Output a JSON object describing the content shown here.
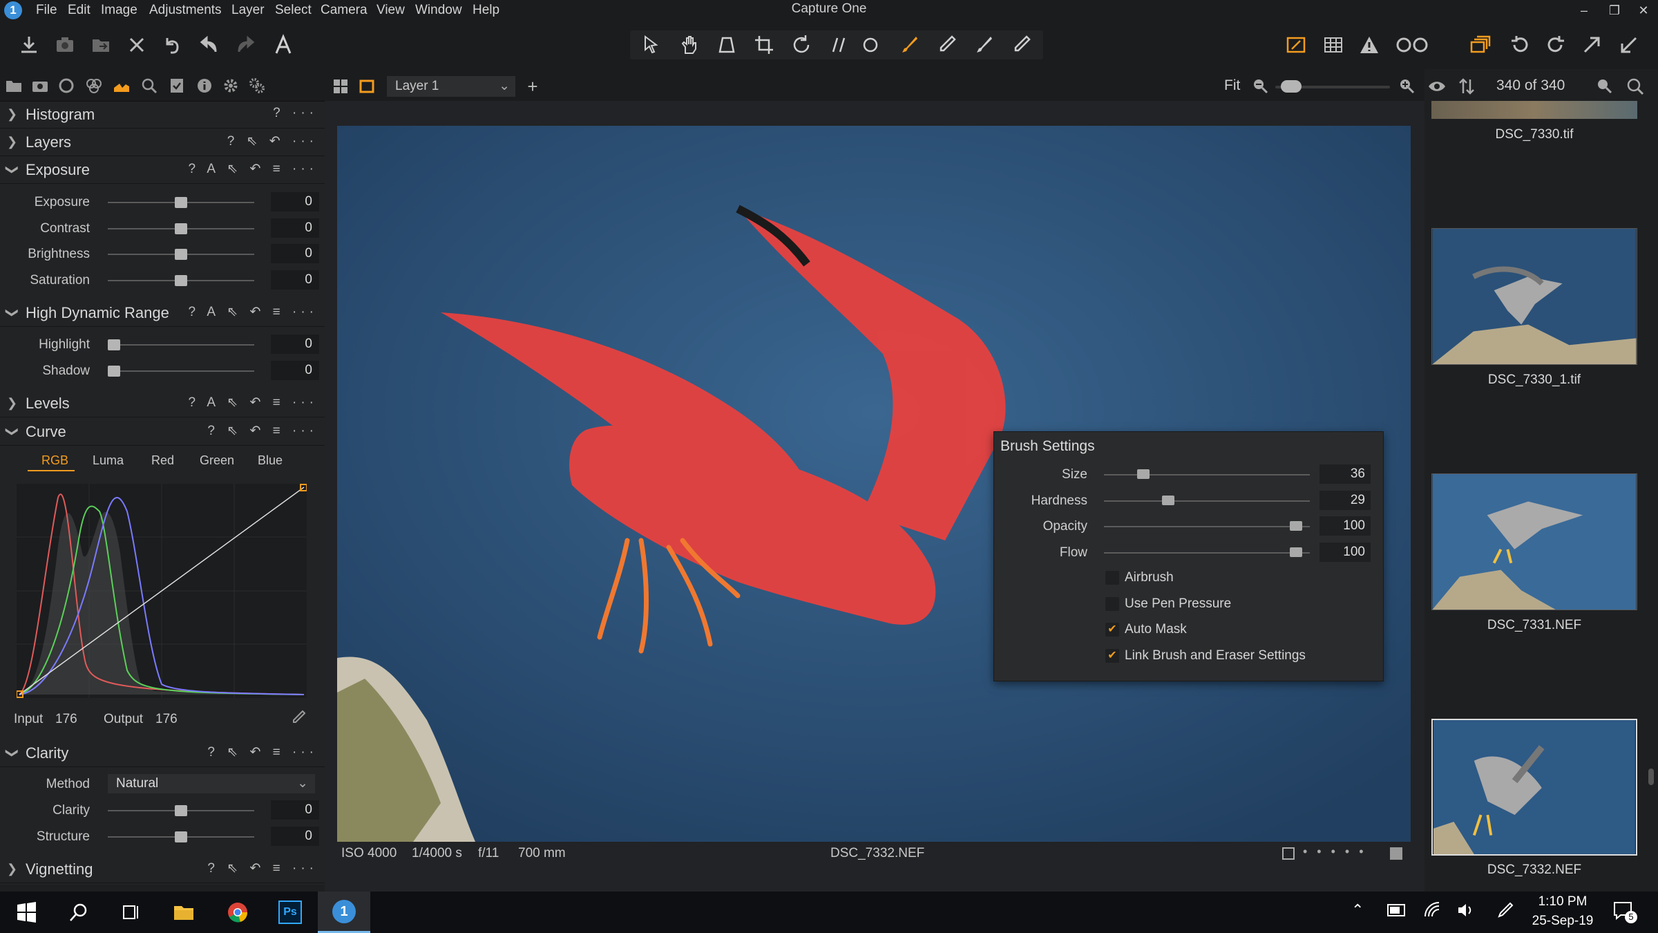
{
  "app": {
    "title": "Capture One",
    "icon_glyph": "1"
  },
  "menu": [
    "File",
    "Edit",
    "Image",
    "Adjustments",
    "Layer",
    "Select",
    "Camera",
    "View",
    "Window",
    "Help"
  ],
  "window_controls": {
    "minimize": "–",
    "maximize": "❐",
    "close": "✕"
  },
  "toolbar": {
    "left_icons": [
      "import-icon",
      "camera-icon",
      "move-to-icon",
      "delete-icon",
      "undo-all-icon",
      "undo-icon",
      "redo-icon",
      "text-icon"
    ],
    "tool_icons": [
      "cursor-tool-icon",
      "pan-tool-icon",
      "keystone-tool-icon",
      "crop-tool-icon",
      "rotate-tool-icon",
      "straighten-tool-icon",
      "spot-tool-icon",
      "brush-tool-icon",
      "eyedropper-tool-icon",
      "eraser-tool-icon",
      "gradient-tool-icon"
    ],
    "right_icons": [
      "exposure-warning-icon",
      "grid-icon",
      "warning-icon",
      "proof-icon",
      "copy-icon",
      "rotate-left-icon",
      "rotate-right-icon",
      "expand-icon",
      "compress-icon"
    ]
  },
  "left_tabs": [
    "library-icon",
    "capture-icon",
    "lens-icon",
    "color-icon",
    "exposure-tab-icon",
    "details-icon",
    "metadata-icon",
    "info-icon",
    "settings-icon",
    "styles-icon"
  ],
  "viewer_bar": {
    "layer": "Layer 1",
    "fit": "Fit",
    "count": "340 of 340",
    "zoom_level": 0.06
  },
  "sections": {
    "histogram": {
      "title": "Histogram",
      "icons": "? ···"
    },
    "layers": {
      "title": "Layers",
      "icons": "? ⇖ ↶ ···"
    },
    "exposure": {
      "title": "Exposure",
      "icons": "? A ⇖ ↶ ≡ ···",
      "rows": [
        {
          "label": "Exposure",
          "value": "0",
          "knob": 0.5
        },
        {
          "label": "Contrast",
          "value": "0",
          "knob": 0.5
        },
        {
          "label": "Brightness",
          "value": "0",
          "knob": 0.5
        },
        {
          "label": "Saturation",
          "value": "0",
          "knob": 0.5
        }
      ]
    },
    "hdr": {
      "title": "High Dynamic Range",
      "icons": "? A ⇖ ↶ ≡ ···",
      "rows": [
        {
          "label": "Highlight",
          "value": "0",
          "knob": 0.0
        },
        {
          "label": "Shadow",
          "value": "0",
          "knob": 0.0
        }
      ]
    },
    "levels": {
      "title": "Levels",
      "icons": "? A ⇖ ↶ ≡ ···"
    },
    "curve": {
      "title": "Curve",
      "icons": "? ⇖ ↶ ≡ ···",
      "tabs": [
        "RGB",
        "Luma",
        "Red",
        "Green",
        "Blue"
      ],
      "active_tab": "RGB",
      "input_label": "Input",
      "input_value": "176",
      "output_label": "Output",
      "output_value": "176"
    },
    "clarity": {
      "title": "Clarity",
      "icons": "? ⇖ ↶ ≡ ···",
      "method_label": "Method",
      "method_value": "Natural",
      "rows": [
        {
          "label": "Clarity",
          "value": "0",
          "knob": 0.5
        },
        {
          "label": "Structure",
          "value": "0",
          "knob": 0.5
        }
      ]
    },
    "vignetting": {
      "title": "Vignetting",
      "icons": "? ⇖ ↶ ≡ ···"
    }
  },
  "brush": {
    "title": "Brush Settings",
    "sliders": [
      {
        "label": "Size",
        "value": "36",
        "knob": 0.17
      },
      {
        "label": "Hardness",
        "value": "29",
        "knob": 0.3
      },
      {
        "label": "Opacity",
        "value": "100",
        "knob": 0.96
      },
      {
        "label": "Flow",
        "value": "100",
        "knob": 0.96
      }
    ],
    "checks": [
      {
        "label": "Airbrush",
        "checked": false
      },
      {
        "label": "Use Pen Pressure",
        "checked": false
      },
      {
        "label": "Auto Mask",
        "checked": true
      },
      {
        "label": "Link Brush and Eraser Settings",
        "checked": true
      }
    ]
  },
  "status": {
    "iso": "ISO 4000",
    "shutter": "1/4000 s",
    "aperture": "f/11",
    "focal": "700 mm",
    "filename": "DSC_7332.NEF"
  },
  "browser": [
    {
      "name": "DSC_7330.tif"
    },
    {
      "name": "DSC_7330_1.tif"
    },
    {
      "name": "DSC_7331.NEF"
    },
    {
      "name": "DSC_7332.NEF"
    }
  ],
  "taskbar": {
    "time": "1:10 PM",
    "date": "25-Sep-19",
    "notif_count": "5",
    "ps_label": "Ps",
    "c1_label": "1"
  },
  "colors": {
    "accent": "#f39c1e",
    "mask": "#e8413f",
    "sea": "#2f5578"
  }
}
